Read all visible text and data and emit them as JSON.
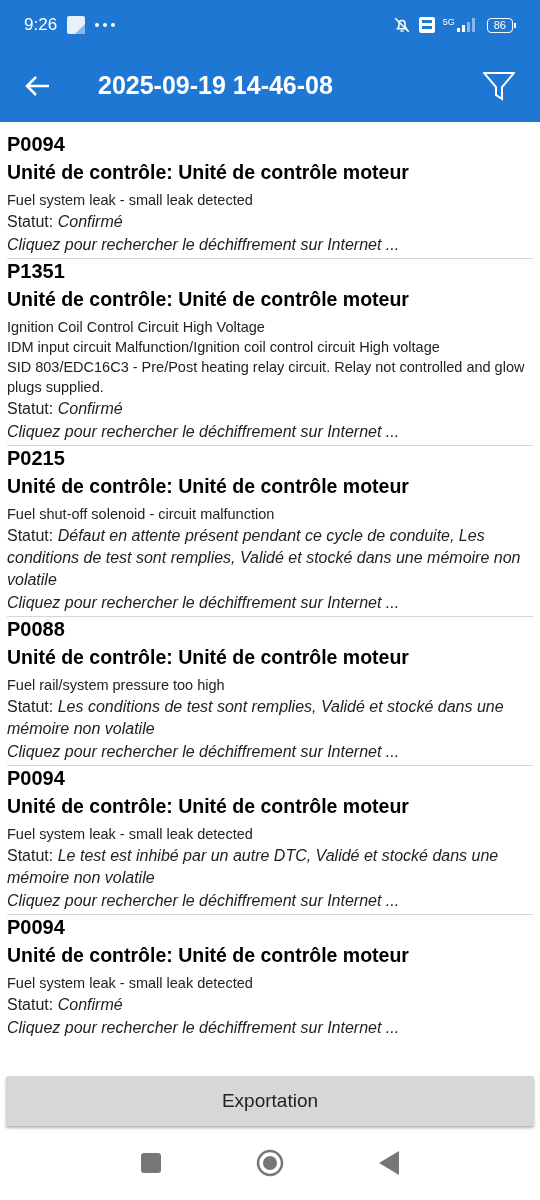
{
  "status_bar": {
    "time": "9:26",
    "network": "5G",
    "battery": "86"
  },
  "app_bar": {
    "title": "2025-09-19 14-46-08"
  },
  "entries": [
    {
      "code": "P0094",
      "unit": "Unité de contrôle: Unité de contrôle moteur",
      "description": "Fuel system leak - small leak detected",
      "status": "Statut: *Confirmé*",
      "link": "Cliquez pour rechercher le déchiffrement sur Internet ..."
    },
    {
      "code": "P1351",
      "unit": "Unité de contrôle: Unité de contrôle moteur",
      "description": "Ignition Coil Control Circuit High Voltage\nIDM input circuit Malfunction/Ignition coil control circuit High voltage\nSID 803/EDC16C3 - Pre/Post heating relay circuit. Relay not controlled and glow plugs supplied.",
      "status": "Statut: *Confirmé*",
      "link": "Cliquez pour rechercher le déchiffrement sur Internet ..."
    },
    {
      "code": "P0215",
      "unit": "Unité de contrôle: Unité de contrôle moteur",
      "description": "Fuel shut-off solenoid - circuit malfunction",
      "status": "Statut: *Défaut en attente présent pendant ce cycle de conduite, Les conditions de test sont remplies, Validé et stocké dans une mémoire non volatile*",
      "link": "Cliquez pour rechercher le déchiffrement sur Internet ..."
    },
    {
      "code": "P0088",
      "unit": "Unité de contrôle: Unité de contrôle moteur",
      "description": "Fuel rail/system pressure too high",
      "status": "Statut: *Les conditions de test sont remplies, Validé et stocké dans une mémoire non volatile*",
      "link": "Cliquez pour rechercher le déchiffrement sur Internet ..."
    },
    {
      "code": "P0094",
      "unit": "Unité de contrôle: Unité de contrôle moteur",
      "description": "Fuel system leak - small leak detected",
      "status": "Statut: *Le test est inhibé par un autre DTC, Validé et stocké dans une mémoire non volatile*",
      "link": "Cliquez pour rechercher le déchiffrement sur Internet ..."
    },
    {
      "code": "P0094",
      "unit": "Unité de contrôle: Unité de contrôle moteur",
      "description": "Fuel system leak - small leak detected",
      "status": "Statut: *Confirmé*",
      "link": "Cliquez pour rechercher le déchiffrement sur Internet ..."
    }
  ],
  "export_button": "Exportation"
}
